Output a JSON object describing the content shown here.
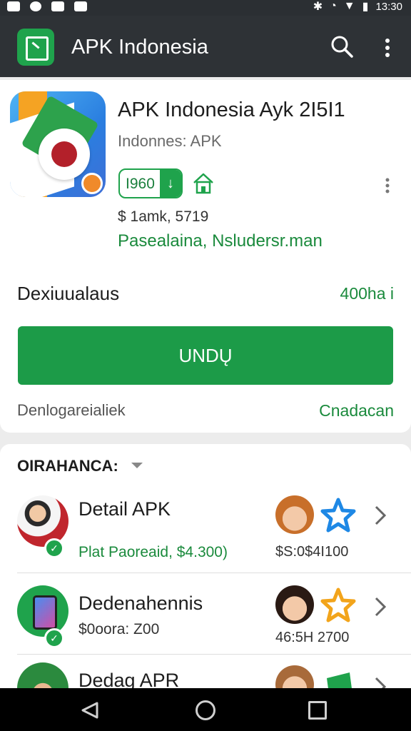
{
  "status_bar": {
    "time": "13:30"
  },
  "app_bar": {
    "title": "APK Indonesia"
  },
  "app": {
    "name": "APK Indonesia Ayk 2I5I1",
    "developer": "Indonnes: APK",
    "rating_badge": "I960",
    "price": "$ 1amk, 5719",
    "categories": "Pasealaina, Nsludersr.man"
  },
  "download": {
    "label": "Dexiuualaus",
    "size": "400ha i",
    "button": "UNDŲ",
    "footer_left": "Denlogareialiek",
    "footer_right": "Cnadacan"
  },
  "section": {
    "title": "OIRAHANCA:"
  },
  "list": [
    {
      "title": "Detail APK",
      "subtitle": "Plat Paoreaid, $4.300)",
      "value": "$S:0$4I100"
    },
    {
      "title": "Dedenahennis",
      "subtitle": "$0oora: Z00",
      "value": "46:5H 2700"
    },
    {
      "title": "Dedag APR",
      "subtitle": "",
      "value": ""
    }
  ],
  "colors": {
    "accent": "#1c9b48",
    "appbar": "#2e3236"
  },
  "icons": [
    "search-icon",
    "more-vert-icon",
    "download-arrow-icon",
    "house-icon",
    "star-icon",
    "chevron-right-icon",
    "check-icon"
  ]
}
